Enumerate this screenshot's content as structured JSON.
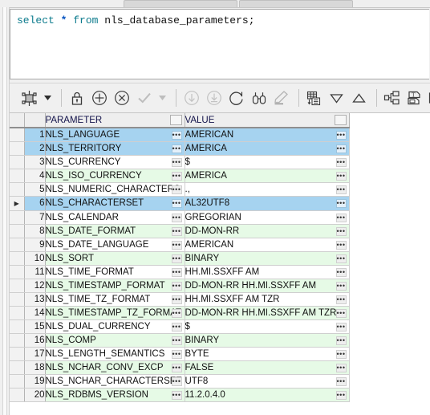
{
  "window": {
    "tabs": [
      "",
      ""
    ]
  },
  "editor": {
    "query": "select * from nls_database_parameters;",
    "tokens": {
      "kw_select": "select",
      "star": "*",
      "kw_from": "from",
      "table": "nls_database_parameters;"
    }
  },
  "toolbar": {
    "items": [
      {
        "name": "freeze-grid-icon",
        "label": "Freeze Grid"
      },
      {
        "name": "chevron-down-icon",
        "label": "More"
      },
      {
        "name": "lock-icon",
        "label": "Lock Record"
      },
      {
        "name": "add-row-icon",
        "label": "Insert Row"
      },
      {
        "name": "delete-row-icon",
        "label": "Delete Row"
      },
      {
        "name": "commit-check-icon",
        "label": "Commit"
      },
      {
        "name": "commit-dropdown-icon",
        "label": "Commit Options"
      },
      {
        "name": "rollback-icon",
        "label": "Rollback"
      },
      {
        "name": "fetch-all-icon",
        "label": "Fetch All Rows"
      },
      {
        "name": "refresh-icon",
        "label": "Refresh"
      },
      {
        "name": "find-icon",
        "label": "Find"
      },
      {
        "name": "eraser-icon",
        "label": "Clear Filter"
      },
      {
        "name": "sql-grid-icon",
        "label": "Show SQL"
      },
      {
        "name": "sort-desc-icon",
        "label": "Sort Descending"
      },
      {
        "name": "sort-asc-icon",
        "label": "Sort Ascending"
      },
      {
        "name": "hierarchy-icon",
        "label": "Single Record View"
      },
      {
        "name": "text-export-icon",
        "label": "Export Text"
      },
      {
        "name": "grid-settings-icon",
        "label": "Grid Settings"
      }
    ]
  },
  "results": {
    "columns": [
      {
        "key": "gutter",
        "label": ""
      },
      {
        "key": "rownum",
        "label": ""
      },
      {
        "key": "parameter",
        "label": "PARAMETER"
      },
      {
        "key": "value",
        "label": "VALUE"
      }
    ],
    "ellipsis_glyph": "•••",
    "current_row_glyph": "▶",
    "current_row": 6,
    "colors": {
      "selection": "#a6d3f0",
      "alt_row": "#e6fae6",
      "header_bg": "#eeeeee",
      "header_text": "#12124a"
    },
    "rows": [
      {
        "n": 1,
        "parameter": "NLS_LANGUAGE",
        "value": "AMERICAN",
        "state": "sel"
      },
      {
        "n": 2,
        "parameter": "NLS_TERRITORY",
        "value": "AMERICA",
        "state": "sel"
      },
      {
        "n": 3,
        "parameter": "NLS_CURRENCY",
        "value": "$",
        "state": "plain"
      },
      {
        "n": 4,
        "parameter": "NLS_ISO_CURRENCY",
        "value": "AMERICA",
        "state": "alt"
      },
      {
        "n": 5,
        "parameter": "NLS_NUMERIC_CHARACTERS",
        "value": ".,",
        "state": "plain"
      },
      {
        "n": 6,
        "parameter": "NLS_CHARACTERSET",
        "value": "AL32UTF8",
        "state": "sel"
      },
      {
        "n": 7,
        "parameter": "NLS_CALENDAR",
        "value": "GREGORIAN",
        "state": "plain"
      },
      {
        "n": 8,
        "parameter": "NLS_DATE_FORMAT",
        "value": "DD-MON-RR",
        "state": "alt"
      },
      {
        "n": 9,
        "parameter": "NLS_DATE_LANGUAGE",
        "value": "AMERICAN",
        "state": "plain"
      },
      {
        "n": 10,
        "parameter": "NLS_SORT",
        "value": "BINARY",
        "state": "alt"
      },
      {
        "n": 11,
        "parameter": "NLS_TIME_FORMAT",
        "value": "HH.MI.SSXFF AM",
        "state": "plain"
      },
      {
        "n": 12,
        "parameter": "NLS_TIMESTAMP_FORMAT",
        "value": "DD-MON-RR HH.MI.SSXFF AM",
        "state": "alt"
      },
      {
        "n": 13,
        "parameter": "NLS_TIME_TZ_FORMAT",
        "value": "HH.MI.SSXFF AM TZR",
        "state": "plain"
      },
      {
        "n": 14,
        "parameter": "NLS_TIMESTAMP_TZ_FORMAT",
        "value": "DD-MON-RR HH.MI.SSXFF AM TZR",
        "state": "alt"
      },
      {
        "n": 15,
        "parameter": "NLS_DUAL_CURRENCY",
        "value": "$",
        "state": "plain"
      },
      {
        "n": 16,
        "parameter": "NLS_COMP",
        "value": "BINARY",
        "state": "alt"
      },
      {
        "n": 17,
        "parameter": "NLS_LENGTH_SEMANTICS",
        "value": "BYTE",
        "state": "plain"
      },
      {
        "n": 18,
        "parameter": "NLS_NCHAR_CONV_EXCP",
        "value": "FALSE",
        "state": "alt"
      },
      {
        "n": 19,
        "parameter": "NLS_NCHAR_CHARACTERSET",
        "value": "UTF8",
        "state": "plain"
      },
      {
        "n": 20,
        "parameter": "NLS_RDBMS_VERSION",
        "value": "11.2.0.4.0",
        "state": "alt"
      }
    ]
  }
}
